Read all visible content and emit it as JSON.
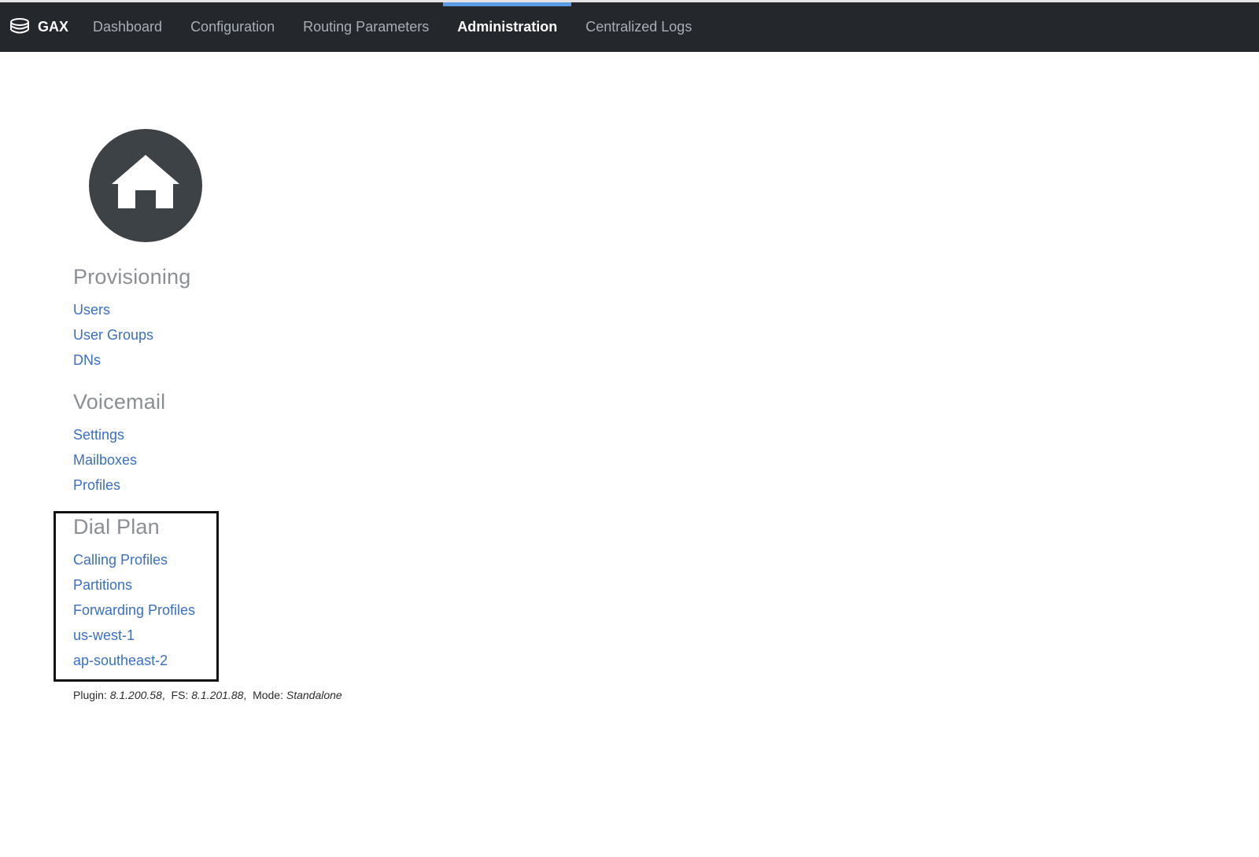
{
  "brand": {
    "name": "GAX"
  },
  "nav": {
    "items": [
      {
        "label": "Dashboard",
        "active": false
      },
      {
        "label": "Configuration",
        "active": false
      },
      {
        "label": "Routing Parameters",
        "active": false
      },
      {
        "label": "Administration",
        "active": true
      },
      {
        "label": "Centralized Logs",
        "active": false
      }
    ]
  },
  "icons": {
    "home": "home-icon",
    "brand": "database-icon"
  },
  "sections": {
    "provisioning": {
      "title": "Provisioning",
      "links": [
        "Users",
        "User Groups",
        "DNs"
      ]
    },
    "voicemail": {
      "title": "Voicemail",
      "links": [
        "Settings",
        "Mailboxes",
        "Profiles"
      ]
    },
    "dial_plan": {
      "title": "Dial Plan",
      "links": [
        "Calling Profiles",
        "Partitions",
        "Forwarding Profiles",
        "us-west-1",
        "ap-southeast-2"
      ]
    }
  },
  "footer": {
    "plugin_label": "Plugin:",
    "plugin_version": "8.1.200.58",
    "fs_label": "FS:",
    "fs_version": "8.1.201.88",
    "mode_label": "Mode:",
    "mode_value": "Standalone"
  },
  "colors": {
    "topbar": "#24272c",
    "accent": "#5c9ce6",
    "link": "#3a6fc4",
    "icon_circle": "#3d4247"
  }
}
